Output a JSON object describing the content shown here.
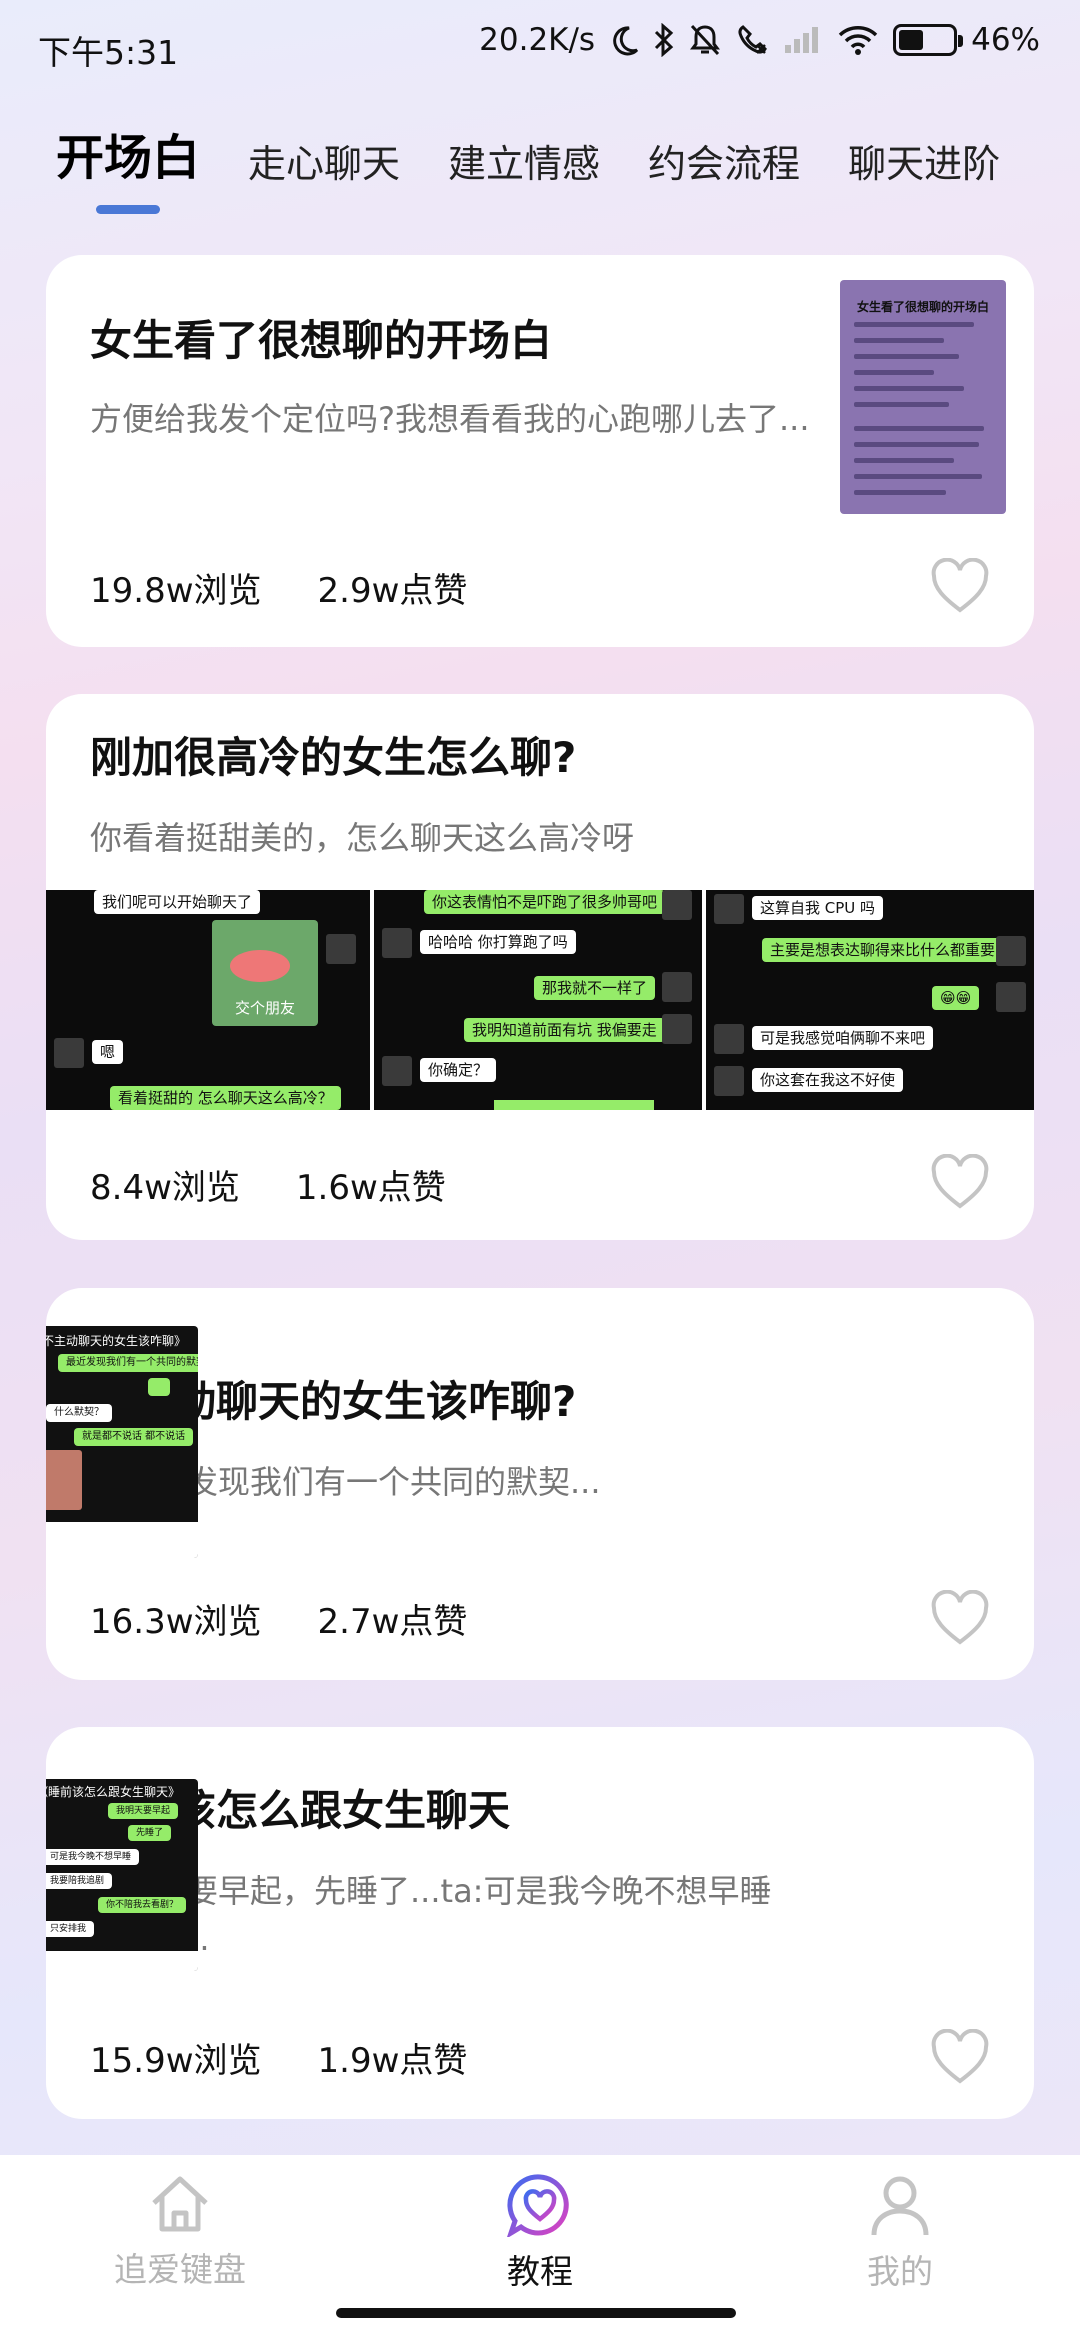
{
  "status_bar": {
    "time": "下午5:31",
    "net_speed": "20.2K/s",
    "battery": "46%",
    "battery_level": 0.46
  },
  "tabs": [
    {
      "label": "开场白",
      "active": true
    },
    {
      "label": "走心聊天",
      "active": false
    },
    {
      "label": "建立情感",
      "active": false
    },
    {
      "label": "约会流程",
      "active": false
    },
    {
      "label": "聊天进阶",
      "active": false
    }
  ],
  "cards": [
    {
      "title": "女生看了很想聊的开场白",
      "summary": "方便给我发个定位吗?我想看看我的心跑哪儿去了...",
      "views": "19.8w浏览",
      "likes": "2.9w点赞",
      "thumb_title": "女生看了很想聊的开场白"
    },
    {
      "title": "刚加很高冷的女生怎么聊?",
      "summary": "你看着挺甜美的，怎么聊天这么高冷呀",
      "views": "8.4w浏览",
      "likes": "1.6w点赞",
      "chat1": [
        "我们呢可以开始聊天了",
        "交个朋友",
        "嗯",
        "看着挺甜的 怎么聊天这么高冷？"
      ],
      "chat2": [
        "你这表情怕不是吓跑了很多帅哥吧",
        "哈哈哈 你打算跑了吗",
        "那我就不一样了",
        "我明知道前面有坑 我偏要走",
        "你确定？"
      ],
      "chat3": [
        "这算自我 CPU 吗",
        "主要是想表达聊得来比什么都重要",
        "😁😁",
        "可是我感觉咱俩聊不来吧",
        "你这套在我这不好使"
      ]
    },
    {
      "title": "不主动聊天的女生该咋聊?",
      "summary": "最近我发现我们有一个共同的默契...",
      "views": "16.3w浏览",
      "likes": "2.7w点赞",
      "thumb_title": "《不主动聊天的女生该咋聊》",
      "thumb_lines": [
        "最近发现我们有一个共同的默契",
        "什么默契？",
        "就是都不说话 都不说话"
      ]
    },
    {
      "title": "睡前该怎么跟女生聊天",
      "summary": "我明天要早起，先睡了...ta:可是我今晚不想早睡(表情)...",
      "views": "15.9w浏览",
      "likes": "1.9w点赞",
      "thumb_title": "《睡前该怎么跟女生聊天》",
      "thumb_lines": [
        "我明天要早起",
        "先睡了",
        "可是我今晚不想早睡",
        "我要陪我追剧",
        "你不陪我去看剧？",
        "只安排我"
      ]
    }
  ],
  "bottom_nav": [
    {
      "label": "追爱键盘",
      "icon": "home-icon",
      "active": false
    },
    {
      "label": "教程",
      "icon": "heart-chat-icon",
      "active": true
    },
    {
      "label": "我的",
      "icon": "person-icon",
      "active": false
    }
  ],
  "colors": {
    "accent": "#4a78d6",
    "chat_green": "#95ec69",
    "nav_active_start": "#3a6cf0",
    "nav_active_end": "#e040c0"
  }
}
